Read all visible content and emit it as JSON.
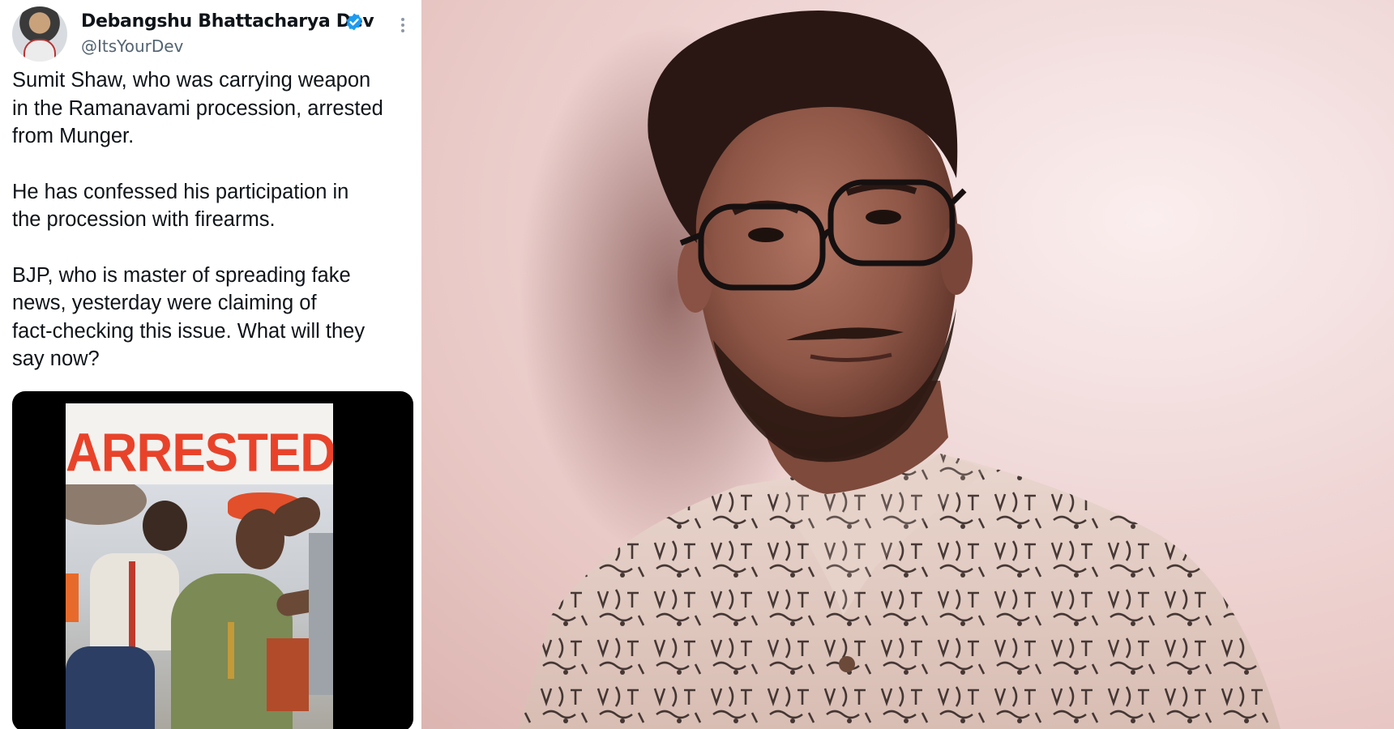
{
  "tweet": {
    "author_name": "Debangshu Bhattacharya Dev",
    "author_handle": "@ItsYourDev",
    "paragraphs": [
      "Sumit Shaw, who was carrying weapon\nin the Ramanavami procession, arrested\nfrom Munger.",
      "He has confessed his participation in\nthe procession with firearms.",
      "BJP, who is master of spreading fake\nnews, yesterday were claiming of\nfact-checking this issue. What will they\nsay now?"
    ],
    "media": {
      "poster_title": "ARRESTED"
    }
  },
  "colors": {
    "text_primary": "#0f1419",
    "text_secondary": "#536471",
    "verified_blue": "#1d9bf0",
    "poster_red": "#e8432a"
  },
  "icons": {
    "verified": "verified-badge-icon",
    "more": "more-options-icon"
  }
}
